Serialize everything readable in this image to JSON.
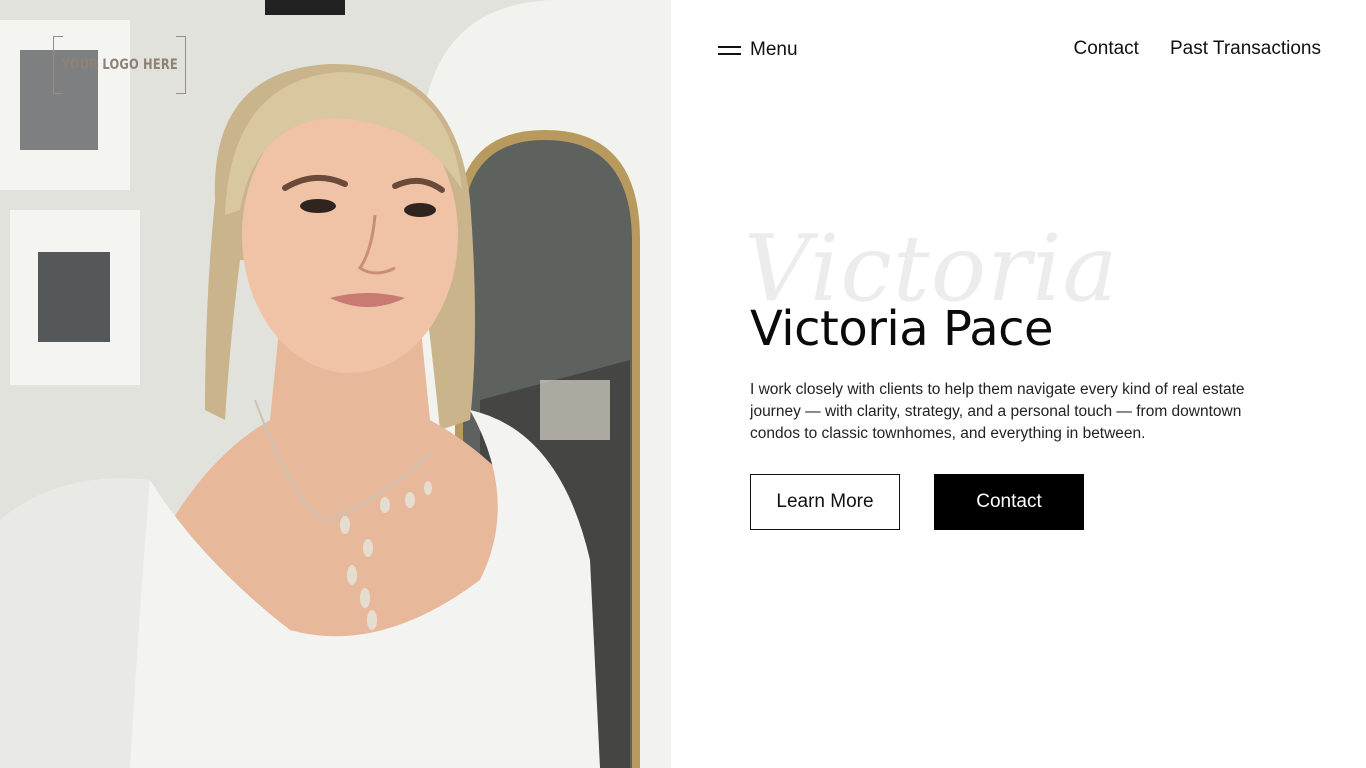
{
  "logo": {
    "text": "YOUR LOGO HERE"
  },
  "nav": {
    "menu_label": "Menu",
    "links": [
      "Contact",
      "Past Transactions"
    ]
  },
  "hero": {
    "script_word": "Victoria",
    "title": "Victoria Pace",
    "description": "I work closely with clients to help them navigate every kind of real estate journey — with clarity, strategy, and a personal touch — from downtown condos to classic townhomes, and everything in between.",
    "buttons": {
      "learn_more": "Learn More",
      "contact": "Contact"
    }
  },
  "colors": {
    "background": "#ffffff",
    "text": "#111111",
    "button_solid": "#000000",
    "script_watermark": "#ececec",
    "logo": "#8f8078"
  }
}
